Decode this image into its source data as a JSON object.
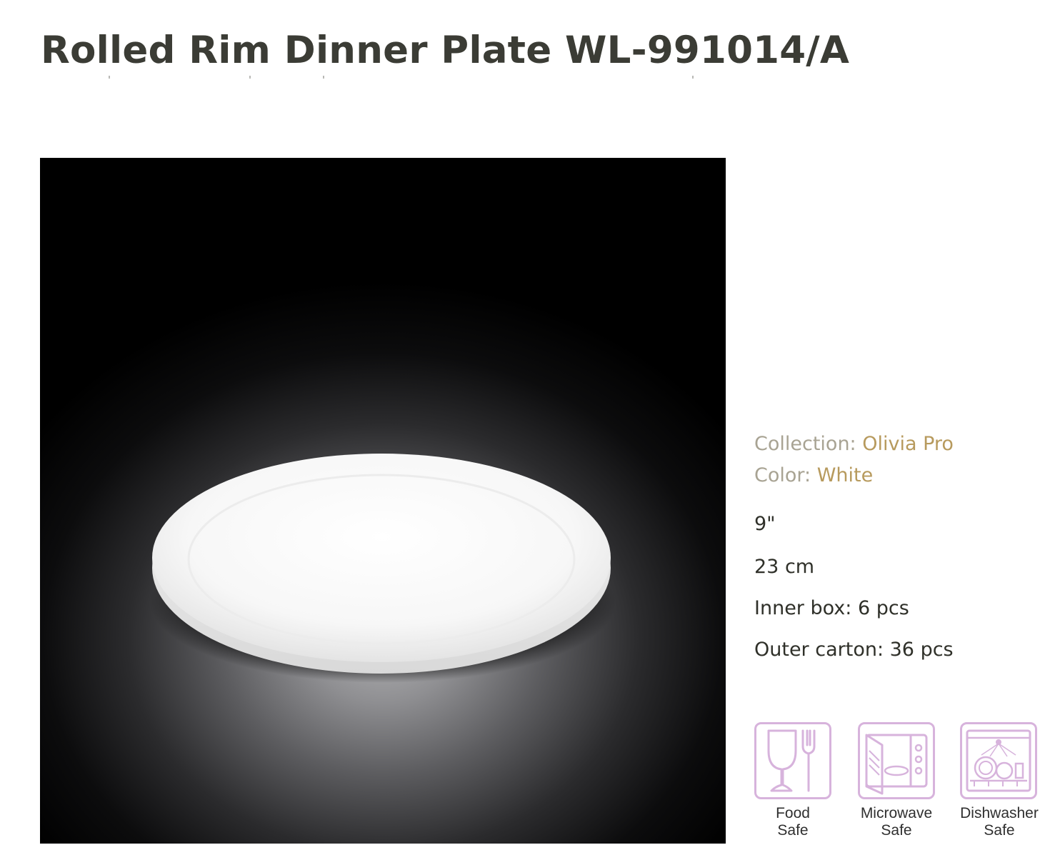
{
  "product": {
    "title": "Rolled Rim Dinner Plate WL-991014/A"
  },
  "specs": {
    "collection_label": "Collection:",
    "collection_value": "Olivia Pro",
    "color_label": "Color:",
    "color_value": "White",
    "size_inches": "9\"",
    "size_cm": "23 cm",
    "inner_box": "Inner box: 6 pcs",
    "outer_carton": "Outer carton: 36 pcs"
  },
  "features": [
    {
      "icon": "food-safe-icon",
      "line1": "Food",
      "line2": "Safe"
    },
    {
      "icon": "microwave-safe-icon",
      "line1": "Microwave",
      "line2": "Safe"
    },
    {
      "icon": "dishwasher-safe-icon",
      "line1": "Dishwasher",
      "line2": "Safe"
    }
  ],
  "colors": {
    "title": "#3b3c35",
    "label": "#a8a393",
    "value": "#b79a5d",
    "icon_stroke": "#d7b3dc"
  }
}
